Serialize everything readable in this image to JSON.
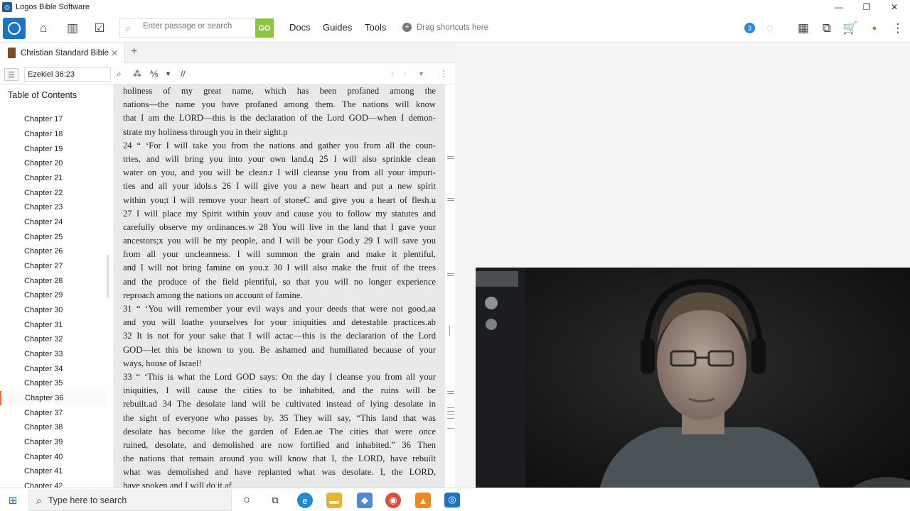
{
  "window": {
    "title": "Logos Bible Software"
  },
  "toolbar": {
    "search_placeholder": "Enter passage or search",
    "go_label": "GO",
    "menus": [
      "Docs",
      "Guides",
      "Tools"
    ],
    "shortcuts_label": "Drag shortcuts here",
    "notification_count": "3"
  },
  "tab": {
    "label": "Christian Standard Bible",
    "new_tab": "+"
  },
  "doc": {
    "reference": "Ezekiel 36:23",
    "parallel": "//"
  },
  "toc": {
    "title": "Table of Contents",
    "chapters": [
      "Chapter 17",
      "Chapter 18",
      "Chapter 19",
      "Chapter 20",
      "Chapter 21",
      "Chapter 22",
      "Chapter 23",
      "Chapter 24",
      "Chapter 25",
      "Chapter 26",
      "Chapter 27",
      "Chapter 28",
      "Chapter 29",
      "Chapter 30",
      "Chapter 31",
      "Chapter 32",
      "Chapter 33",
      "Chapter 34",
      "Chapter 35",
      "Chapter 36",
      "Chapter 37",
      "Chapter 38",
      "Chapter 39",
      "Chapter 40",
      "Chapter 41",
      "Chapter 42"
    ],
    "selected": "Chapter 36"
  },
  "reader": {
    "lines": [
      "holiness of my great name, which has been profaned among the",
      "nations—the name you have profaned among them. The nations will know",
      "that I am the LORD—this is the declaration of the Lord GOD—when I demon-",
      "strate my holiness through you in their sight.p",
      "24 “ ‘For I will take you from the nations and gather you from all the coun-",
      "tries, and will bring you into your own land.q 25 I will also sprinkle clean",
      "water on you, and you will be clean.r I will cleanse you from all your impuri-",
      "ties and all your idols.s 26 I will give you a new heart and put a new spirit",
      "within you;t I will remove your heart of stoneC and give you a heart of flesh.u",
      "27 I will place my Spirit within youv and cause you to follow my statutes and",
      "carefully observe my ordinances.w 28 You will live in the land that I gave your",
      "ancestors;x you will be my people, and I will be your God.y 29 I will save you",
      "from all your uncleanness. I will summon the grain and make it plentiful,",
      "and I will not bring famine on you.z 30 I will also make the fruit of the trees",
      "and the produce of the field plentiful, so that you will no longer experience",
      "reproach among the nations on account of famine.",
      "31 “ ‘You will remember your evil ways and your deeds that were not good,aa",
      "and you will loathe yourselves for your iniquities and detestable practices.ab",
      "32 It is not for your sake that I will actac—this is the declaration of the Lord",
      "GOD—let this be known to you. Be ashamed and humiliated because of your",
      "ways, house of Israel!",
      "33 “ ‘This is what the Lord GOD says: On the day I cleanse you from all your",
      "iniquities, I will cause the cities to be inhabited, and the ruins will be",
      "rebuilt.ad 34 The desolate land will be cultivated instead of lying desolate in",
      "the sight of everyone who passes by. 35 They will say, “This land that was",
      "desolate has become like the garden of Eden.ae The cities that were once",
      "ruined, desolate, and demolished are now fortified and inhabited.” 36 Then",
      "the nations that remain around you will know that I, the LORD, have rebuilt",
      "what was demolished and have replanted what was desolate. I, the LORD,",
      "have spoken and I will do it.af"
    ]
  },
  "taskbar": {
    "search_placeholder": "Type here to search"
  }
}
